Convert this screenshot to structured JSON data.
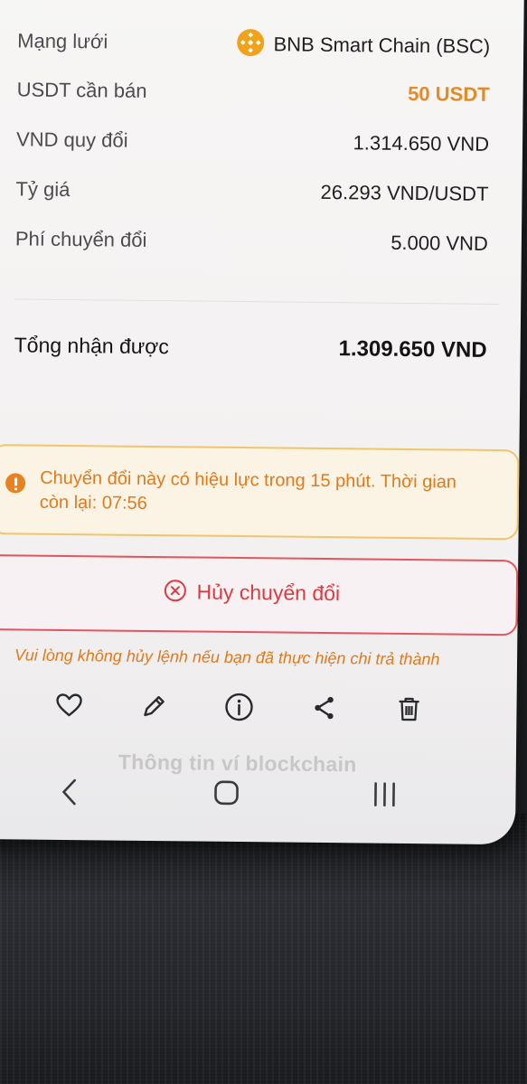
{
  "details": {
    "network_label": "Mạng lưới",
    "network_value": "BNB Smart Chain (BSC)",
    "network_icon": "bnb-logo-icon",
    "usdt_label": "USDT cần bán",
    "usdt_value": "50 USDT",
    "vnd_label": "VND quy đổi",
    "vnd_value": "1.314.650 VND",
    "rate_label": "Tỷ giá",
    "rate_value": "26.293 VND/USDT",
    "fee_label": "Phí chuyển đổi",
    "fee_value": "5.000 VND",
    "total_label": "Tổng nhận được",
    "total_value": "1.309.650 VND"
  },
  "warning": {
    "icon": "alert-icon",
    "text": "Chuyển đổi này có hiệu lực trong 15 phút. Thời gian còn lại: 07:56"
  },
  "cancel": {
    "icon": "x-circle-icon",
    "label": "Hủy chuyển đổi"
  },
  "note": "Vui lòng không hủy lệnh nếu bạn đã thực hiện chi trả thành",
  "actions": [
    "heart-icon",
    "pencil-icon",
    "info-icon",
    "share-icon",
    "trash-icon"
  ],
  "ghost_text": "Thông tin ví blockchain",
  "colors": {
    "accent_orange": "#e48b26",
    "warning_bg": "#fbf3e3",
    "warning_border": "#f2c56a",
    "danger_red": "#dd3a3f"
  }
}
